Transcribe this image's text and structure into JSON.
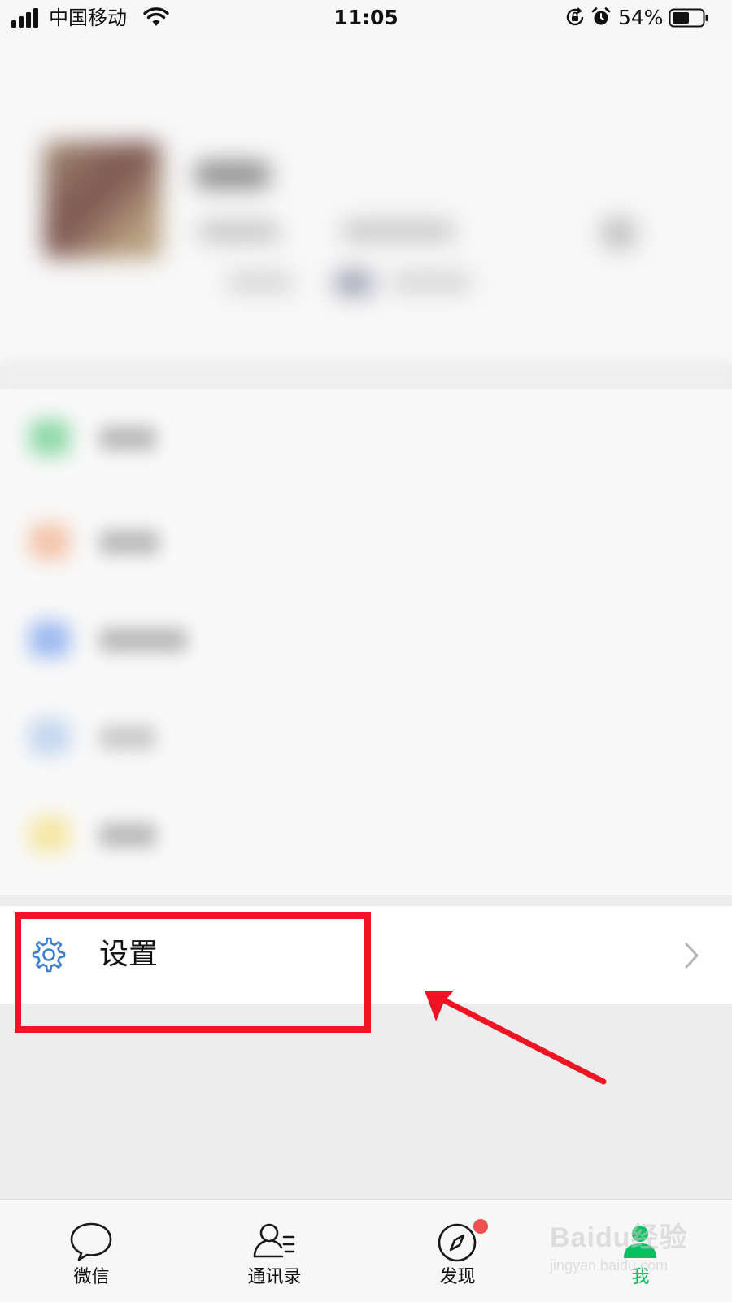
{
  "status_bar": {
    "carrier": "中国移动",
    "time": "11:05",
    "battery_percent": "54%",
    "icons": [
      "signal-icon",
      "wifi-icon",
      "rotation-lock-icon",
      "alarm-icon",
      "battery-icon"
    ]
  },
  "settings_row": {
    "label": "设置",
    "icon": "gear-icon",
    "accent_color": "#3f7fd0"
  },
  "annotation": {
    "highlight_color": "#ee1423"
  },
  "tab_bar": {
    "active_tab": "我",
    "active_color": "#07c160",
    "badge_color": "#f05050",
    "tabs": [
      {
        "label": "微信",
        "icon": "chat-bubble-icon"
      },
      {
        "label": "通讯录",
        "icon": "contacts-icon"
      },
      {
        "label": "发现",
        "icon": "compass-icon",
        "has_badge": true
      },
      {
        "label": "我",
        "icon": "profile-icon"
      }
    ]
  },
  "watermark": {
    "brand": "Baidu经验",
    "url": "jingyan.baidu.com"
  }
}
